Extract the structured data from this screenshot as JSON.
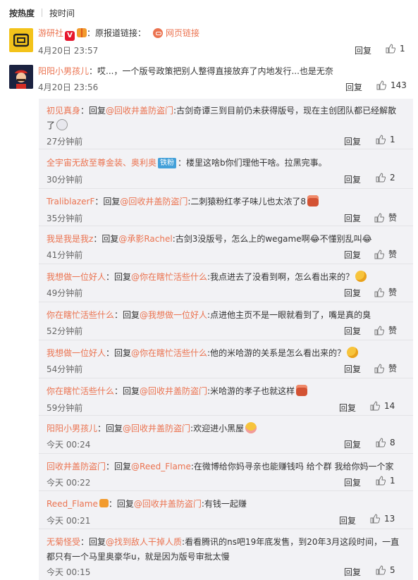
{
  "sort": {
    "hot": "按热度",
    "time": "按时间"
  },
  "main_comments": [
    {
      "user": "游研社",
      "v_badge": "V",
      "text_prefix": "：原报道链接：",
      "link_label": "网页链接",
      "time": "4月20日 23:57",
      "reply": "回复",
      "likes": "1"
    },
    {
      "user": "阳阳小男孩儿",
      "text": "：哎...，一个版号政策把别人整得直接放弃了内地发行...也是无奈",
      "time": "4月20日 23:56",
      "reply": "回复",
      "likes": "143"
    }
  ],
  "replies": [
    {
      "user": "初见真身",
      "sep": "：回复",
      "target": "@回收井盖防盗门",
      "text": ":古剑奇谭三到目前仍未获得版号，现在主创团队都已经解散",
      "text2": "了",
      "time": "27分钟前",
      "reply": "回复",
      "likes": "1"
    },
    {
      "user": "全宇宙无敌至尊金装、奥利奥",
      "badge": "铁粉",
      "text": "：楼里这啥b你们理他干啥。拉黑完事。",
      "time": "30分钟前",
      "reply": "回复",
      "likes": "2"
    },
    {
      "user": "TraliblazerF",
      "sep": "：回复",
      "target": "@回收井盖防盗门",
      "text": ":二刺猿粉红孝子味儿也太浓了8",
      "time": "35分钟前",
      "reply": "回复",
      "likes": "赞"
    },
    {
      "user": "我是我是我z",
      "sep": "：回复",
      "target": "@承影Rachel",
      "text": ":古剑3没版号，怎么上的wegame啊😂不懂别乱叫😂",
      "time": "41分钟前",
      "reply": "回复",
      "likes": "赞"
    },
    {
      "user": "我想做一位好人",
      "sep": "：回复",
      "target": "@你在瞎忙活些什么",
      "text": ":我点进去了没看到啊，怎么看出来的？",
      "time": "49分钟前",
      "reply": "回复",
      "likes": "赞"
    },
    {
      "user": "你在瞎忙活些什么",
      "sep": "：回复",
      "target": "@我想做一位好人",
      "text": ":点进他主页不是一眼就看到了，嘴是真的臭",
      "time": "52分钟前",
      "reply": "回复",
      "likes": "赞"
    },
    {
      "user": "我想做一位好人",
      "sep": "：回复",
      "target": "@你在瞎忙活些什么",
      "text": ":他的米哈游的关系是怎么看出来的？",
      "time": "54分钟前",
      "reply": "回复",
      "likes": "赞"
    },
    {
      "user": "你在瞎忙活些什么",
      "sep": "：回复",
      "target": "@回收井盖防盗门",
      "text": ":米哈游的孝子也就这样",
      "time": "59分钟前",
      "reply": "回复",
      "likes": "14"
    },
    {
      "user": "阳阳小男孩儿",
      "sep": "：回复",
      "target": "@回收井盖防盗门",
      "text": ":欢迎进小黑屋",
      "time": "今天 00:24",
      "reply": "回复",
      "likes": "8"
    },
    {
      "user": "回收井盖防盗门",
      "sep": "：回复",
      "target": "@Reed_Flame",
      "text": ":在微博给你妈寻亲也能赚钱吗 给个群 我给你妈一个家",
      "time": "今天 00:22",
      "reply": "回复",
      "likes": "1"
    },
    {
      "user": "Reed_Flame",
      "sep": "：回复",
      "target": "@回收井盖防盗门",
      "text": ":有钱一起赚",
      "time": "今天 00:21",
      "reply": "回复",
      "likes": "13"
    },
    {
      "user": "无菊怪受",
      "sep": "：回复",
      "target": "@找到敌人干掉人质",
      "text": ":看看腾讯的ns吧19年底发售，到20年3月这段时间，一直",
      "text2": "都只有一个马里奥豪华u，就是因为版号审批太慢",
      "time": "今天 00:15",
      "reply": "回复",
      "likes": "5"
    }
  ]
}
